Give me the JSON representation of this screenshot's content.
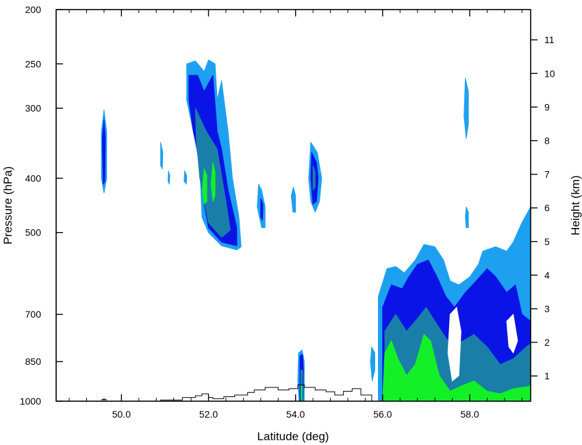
{
  "chart_data": {
    "type": "heatmap",
    "title": "",
    "xlabel": "Latitude (deg)",
    "ylabel_left": "Pressure (hPa)",
    "ylabel_right": "Height (km)",
    "xlim": [
      48.5,
      59.4
    ],
    "pressure_range_hPa": [
      200,
      1000
    ],
    "height_range_km": [
      0.25,
      11.9
    ],
    "log_pressure_scale": true,
    "x_ticks": [
      {
        "value": 50,
        "label": "50.0"
      },
      {
        "value": 52,
        "label": "52.0"
      },
      {
        "value": 54,
        "label": "54.0"
      },
      {
        "value": 56,
        "label": "56.0"
      },
      {
        "value": 58,
        "label": "58.0"
      }
    ],
    "x_minor_step": 0.4,
    "pressure_ticks": [
      {
        "value": 200,
        "label": "200"
      },
      {
        "value": 250,
        "label": "250"
      },
      {
        "value": 300,
        "label": "300"
      },
      {
        "value": 400,
        "label": "400"
      },
      {
        "value": 500,
        "label": "500"
      },
      {
        "value": 700,
        "label": "700"
      },
      {
        "value": 850,
        "label": "850"
      },
      {
        "value": 1000,
        "label": "1000"
      }
    ],
    "height_ticks": [
      {
        "value": 1,
        "label": "1"
      },
      {
        "value": 2,
        "label": "2"
      },
      {
        "value": 3,
        "label": "3"
      },
      {
        "value": 4,
        "label": "4"
      },
      {
        "value": 5,
        "label": "5"
      },
      {
        "value": 6,
        "label": "6"
      },
      {
        "value": 7,
        "label": "7"
      },
      {
        "value": 8,
        "label": "8"
      },
      {
        "value": 9,
        "label": "9"
      },
      {
        "value": 10,
        "label": "10"
      },
      {
        "value": 11,
        "label": "11"
      }
    ],
    "grid": false,
    "level_colors": [
      "#1ea0f0",
      "#0a14e6",
      "#1a7fa8",
      "#14f028"
    ],
    "terrain_color": "#000000",
    "regions": [
      {
        "level": 0,
        "points": [
          [
            49.6,
            302
          ],
          [
            49.66,
            330
          ],
          [
            49.66,
            400
          ],
          [
            49.6,
            425
          ],
          [
            49.54,
            400
          ],
          [
            49.54,
            330
          ]
        ]
      },
      {
        "level": 1,
        "points": [
          [
            49.6,
            315
          ],
          [
            49.63,
            340
          ],
          [
            49.62,
            405
          ],
          [
            49.58,
            410
          ],
          [
            49.56,
            340
          ]
        ]
      },
      {
        "level": 0,
        "points": [
          [
            51.5,
            250
          ],
          [
            51.7,
            247
          ],
          [
            51.9,
            258
          ],
          [
            52.0,
            246
          ],
          [
            52.15,
            250
          ],
          [
            52.2,
            290
          ],
          [
            52.3,
            268
          ],
          [
            52.45,
            330
          ],
          [
            52.55,
            400
          ],
          [
            52.7,
            470
          ],
          [
            52.75,
            530
          ],
          [
            52.65,
            537
          ],
          [
            52.3,
            528
          ],
          [
            52.0,
            500
          ],
          [
            51.85,
            470
          ],
          [
            51.8,
            380
          ],
          [
            51.65,
            330
          ],
          [
            51.5,
            290
          ]
        ]
      },
      {
        "level": 1,
        "points": [
          [
            51.55,
            262
          ],
          [
            51.75,
            262
          ],
          [
            51.9,
            280
          ],
          [
            52.1,
            262
          ],
          [
            52.2,
            330
          ],
          [
            52.3,
            355
          ],
          [
            52.45,
            420
          ],
          [
            52.65,
            490
          ],
          [
            52.65,
            528
          ],
          [
            52.3,
            520
          ],
          [
            52.0,
            490
          ],
          [
            51.9,
            445
          ],
          [
            51.8,
            370
          ],
          [
            51.65,
            330
          ],
          [
            51.55,
            290
          ]
        ]
      },
      {
        "level": 2,
        "points": [
          [
            51.7,
            300
          ],
          [
            51.95,
            330
          ],
          [
            52.2,
            355
          ],
          [
            52.4,
            440
          ],
          [
            52.5,
            495
          ],
          [
            52.3,
            510
          ],
          [
            52.0,
            480
          ],
          [
            51.8,
            400
          ],
          [
            51.72,
            340
          ]
        ]
      },
      {
        "level": 3,
        "points": [
          [
            51.9,
            385
          ],
          [
            51.96,
            395
          ],
          [
            51.96,
            440
          ],
          [
            51.9,
            445
          ],
          [
            51.86,
            420
          ]
        ]
      },
      {
        "level": 3,
        "points": [
          [
            52.1,
            375
          ],
          [
            52.15,
            390
          ],
          [
            52.15,
            430
          ],
          [
            52.1,
            440
          ],
          [
            52.06,
            410
          ]
        ]
      },
      {
        "level": 0,
        "points": [
          [
            50.9,
            345
          ],
          [
            50.95,
            360
          ],
          [
            50.94,
            385
          ],
          [
            50.9,
            380
          ]
        ]
      },
      {
        "level": 0,
        "points": [
          [
            51.08,
            388
          ],
          [
            51.11,
            395
          ],
          [
            51.1,
            410
          ],
          [
            51.07,
            405
          ]
        ]
      },
      {
        "level": 0,
        "points": [
          [
            51.45,
            388
          ],
          [
            51.5,
            396
          ],
          [
            51.49,
            410
          ],
          [
            51.44,
            405
          ]
        ]
      },
      {
        "level": 0,
        "points": [
          [
            53.15,
            410
          ],
          [
            53.22,
            420
          ],
          [
            53.3,
            450
          ],
          [
            53.3,
            490
          ],
          [
            53.22,
            490
          ],
          [
            53.12,
            450
          ]
        ]
      },
      {
        "level": 1,
        "points": [
          [
            53.2,
            435
          ],
          [
            53.25,
            445
          ],
          [
            53.24,
            475
          ],
          [
            53.2,
            470
          ]
        ]
      },
      {
        "level": 0,
        "points": [
          [
            53.95,
            415
          ],
          [
            54.0,
            430
          ],
          [
            54.0,
            460
          ],
          [
            53.94,
            460
          ],
          [
            53.9,
            430
          ]
        ]
      },
      {
        "level": 0,
        "points": [
          [
            54.35,
            345
          ],
          [
            54.5,
            360
          ],
          [
            54.6,
            400
          ],
          [
            54.55,
            440
          ],
          [
            54.45,
            460
          ],
          [
            54.35,
            440
          ],
          [
            54.3,
            400
          ]
        ]
      },
      {
        "level": 1,
        "points": [
          [
            54.37,
            360
          ],
          [
            54.48,
            375
          ],
          [
            54.52,
            400
          ],
          [
            54.48,
            440
          ],
          [
            54.4,
            445
          ],
          [
            54.35,
            400
          ]
        ]
      },
      {
        "level": 2,
        "points": [
          [
            54.4,
            380
          ],
          [
            54.45,
            390
          ],
          [
            54.45,
            415
          ],
          [
            54.4,
            420
          ]
        ]
      },
      {
        "level": 0,
        "points": [
          [
            57.9,
            265
          ],
          [
            57.97,
            280
          ],
          [
            57.97,
            320
          ],
          [
            57.92,
            340
          ],
          [
            57.87,
            310
          ]
        ]
      },
      {
        "level": 0,
        "points": [
          [
            57.92,
            450
          ],
          [
            57.97,
            460
          ],
          [
            57.97,
            490
          ],
          [
            57.92,
            490
          ],
          [
            57.9,
            470
          ]
        ]
      },
      {
        "level": 0,
        "points": [
          [
            54.07,
            820
          ],
          [
            54.15,
            810
          ],
          [
            54.2,
            850
          ],
          [
            54.2,
            1000
          ],
          [
            54.08,
            1000
          ],
          [
            54.05,
            920
          ]
        ]
      },
      {
        "level": 1,
        "points": [
          [
            54.1,
            830
          ],
          [
            54.16,
            825
          ],
          [
            54.18,
            880
          ],
          [
            54.17,
            1000
          ],
          [
            54.1,
            1000
          ]
        ]
      },
      {
        "level": 2,
        "points": [
          [
            54.12,
            880
          ],
          [
            54.16,
            880
          ],
          [
            54.16,
            1000
          ],
          [
            54.12,
            1000
          ]
        ]
      },
      {
        "level": 3,
        "points": [
          [
            54.13,
            940
          ],
          [
            54.15,
            940
          ],
          [
            54.15,
            1000
          ],
          [
            54.13,
            1000
          ]
        ]
      },
      {
        "level": 0,
        "points": [
          [
            55.75,
            800
          ],
          [
            55.82,
            820
          ],
          [
            55.82,
            880
          ],
          [
            55.76,
            920
          ],
          [
            55.72,
            850
          ]
        ]
      },
      {
        "level": 0,
        "points": [
          [
            55.9,
            1000
          ],
          [
            55.9,
            650
          ],
          [
            56.1,
            580
          ],
          [
            56.3,
            575
          ],
          [
            56.5,
            590
          ],
          [
            56.75,
            560
          ],
          [
            56.95,
            525
          ],
          [
            57.2,
            530
          ],
          [
            57.4,
            560
          ],
          [
            57.55,
            610
          ],
          [
            57.75,
            620
          ],
          [
            58.0,
            600
          ],
          [
            58.2,
            570
          ],
          [
            58.3,
            540
          ],
          [
            58.6,
            530
          ],
          [
            58.85,
            540
          ],
          [
            59.0,
            520
          ],
          [
            59.2,
            480
          ],
          [
            59.4,
            450
          ],
          [
            59.4,
            1000
          ]
        ]
      },
      {
        "level": 1,
        "points": [
          [
            56.0,
            1000
          ],
          [
            56.0,
            680
          ],
          [
            56.2,
            620
          ],
          [
            56.45,
            630
          ],
          [
            56.6,
            600
          ],
          [
            56.8,
            570
          ],
          [
            57.05,
            560
          ],
          [
            57.25,
            600
          ],
          [
            57.45,
            650
          ],
          [
            57.65,
            680
          ],
          [
            57.9,
            640
          ],
          [
            58.15,
            610
          ],
          [
            58.4,
            580
          ],
          [
            58.6,
            600
          ],
          [
            58.85,
            640
          ],
          [
            59.05,
            620
          ],
          [
            59.2,
            700
          ],
          [
            59.4,
            720
          ],
          [
            59.4,
            1000
          ]
        ]
      },
      {
        "level": 2,
        "points": [
          [
            56.05,
            1000
          ],
          [
            56.05,
            750
          ],
          [
            56.3,
            700
          ],
          [
            56.55,
            750
          ],
          [
            56.75,
            720
          ],
          [
            57.0,
            680
          ],
          [
            57.2,
            720
          ],
          [
            57.4,
            760
          ],
          [
            57.6,
            800
          ],
          [
            57.85,
            780
          ],
          [
            58.1,
            760
          ],
          [
            58.4,
            800
          ],
          [
            58.7,
            860
          ],
          [
            59.0,
            840
          ],
          [
            59.3,
            800
          ],
          [
            59.4,
            790
          ],
          [
            59.4,
            1000
          ]
        ]
      },
      {
        "level": 3,
        "points": [
          [
            56.0,
            1000
          ],
          [
            56.05,
            820
          ],
          [
            56.2,
            780
          ],
          [
            56.35,
            840
          ],
          [
            56.55,
            900
          ],
          [
            56.75,
            860
          ],
          [
            56.95,
            760
          ],
          [
            57.1,
            780
          ],
          [
            57.3,
            900
          ],
          [
            57.55,
            960
          ],
          [
            57.8,
            940
          ],
          [
            58.1,
            920
          ],
          [
            58.4,
            960
          ],
          [
            58.7,
            970
          ],
          [
            59.0,
            950
          ],
          [
            59.4,
            940
          ],
          [
            59.4,
            1000
          ]
        ]
      }
    ],
    "holes": [
      {
        "points": [
          [
            57.55,
            700
          ],
          [
            57.7,
            680
          ],
          [
            57.8,
            750
          ],
          [
            57.75,
            900
          ],
          [
            57.6,
            920
          ],
          [
            57.5,
            820
          ]
        ]
      },
      {
        "points": [
          [
            58.85,
            720
          ],
          [
            59.0,
            700
          ],
          [
            59.1,
            780
          ],
          [
            59.0,
            820
          ],
          [
            58.9,
            800
          ]
        ]
      }
    ],
    "terrain": [
      [
        49.55,
        1000
      ],
      [
        49.55,
        993
      ],
      [
        49.65,
        993
      ],
      [
        49.65,
        1000
      ],
      [
        50.9,
        1000
      ],
      [
        50.9,
        995
      ],
      [
        51.4,
        995
      ],
      [
        51.4,
        985
      ],
      [
        51.7,
        985
      ],
      [
        51.7,
        978
      ],
      [
        51.85,
        978
      ],
      [
        51.85,
        970
      ],
      [
        52.0,
        970
      ],
      [
        52.0,
        985
      ],
      [
        52.1,
        985
      ],
      [
        52.1,
        990
      ],
      [
        52.35,
        990
      ],
      [
        52.35,
        982
      ],
      [
        52.6,
        982
      ],
      [
        52.6,
        975
      ],
      [
        52.9,
        975
      ],
      [
        52.9,
        965
      ],
      [
        53.05,
        965
      ],
      [
        53.05,
        955
      ],
      [
        53.3,
        955
      ],
      [
        53.3,
        945
      ],
      [
        53.6,
        945
      ],
      [
        53.6,
        955
      ],
      [
        53.85,
        955
      ],
      [
        53.85,
        950
      ],
      [
        54.05,
        950
      ],
      [
        54.05,
        935
      ],
      [
        54.2,
        935
      ],
      [
        54.2,
        945
      ],
      [
        54.45,
        945
      ],
      [
        54.45,
        955
      ],
      [
        54.7,
        955
      ],
      [
        54.7,
        962
      ],
      [
        54.9,
        962
      ],
      [
        54.9,
        975
      ],
      [
        55.1,
        975
      ],
      [
        55.1,
        960
      ],
      [
        55.3,
        960
      ],
      [
        55.3,
        950
      ],
      [
        55.5,
        950
      ],
      [
        55.5,
        975
      ],
      [
        55.75,
        975
      ],
      [
        55.75,
        1000
      ]
    ]
  }
}
